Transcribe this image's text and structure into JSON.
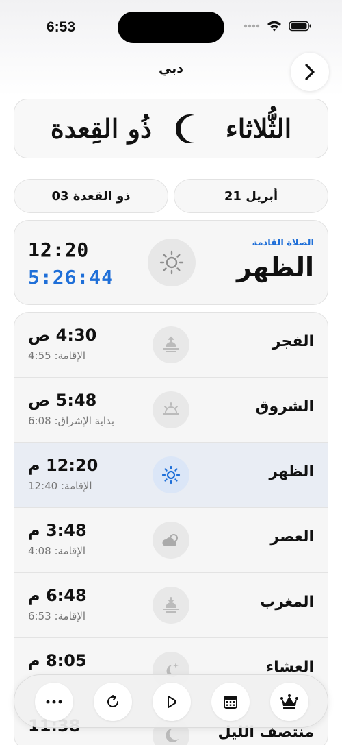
{
  "status_bar": {
    "time": "6:53"
  },
  "header": {
    "city": "دبي",
    "back_icon": "chevron-right-icon"
  },
  "calligraphy": {
    "day": "الثُّلاثاء",
    "month": "ذُو القِعدة",
    "crescent_icon": "crescent-moon-icon"
  },
  "dates": {
    "gregorian": "21 أبريل",
    "hijri": "03 ذو القعدة"
  },
  "next_prayer": {
    "label": "الصلاة القادمة",
    "name": "الظهر",
    "time": "12:20",
    "countdown": "5:26:44",
    "icon": "sun-icon"
  },
  "prayers": [
    {
      "name": "الفجر",
      "time": "4:30 ص",
      "sub": "الإقامة: 4:55",
      "icon": "sunrise-icon",
      "active": false
    },
    {
      "name": "الشروق",
      "time": "5:48 ص",
      "sub": "بداية الإشراق: 6:08",
      "icon": "sunrise-horizon-icon",
      "active": false
    },
    {
      "name": "الظهر",
      "time": "12:20 م",
      "sub": "الإقامة: 12:40",
      "icon": "sun-icon",
      "active": true
    },
    {
      "name": "العصر",
      "time": "3:48 م",
      "sub": "الإقامة: 4:08",
      "icon": "cloud-sun-icon",
      "active": false
    },
    {
      "name": "المغرب",
      "time": "6:48 م",
      "sub": "الإقامة: 6:53",
      "icon": "sunset-icon",
      "active": false
    },
    {
      "name": "العشاء",
      "time": "8:05 م",
      "sub": "",
      "icon": "moon-stars-icon",
      "active": false
    },
    {
      "name": "منتصف الليل",
      "time": "11:38",
      "sub": "",
      "icon": "moon-icon",
      "active": false
    }
  ],
  "toolbar": [
    "more-icon",
    "refresh-icon",
    "speaker-icon",
    "calendar-icon",
    "crown-icon"
  ],
  "colors": {
    "accent": "#1f6fd8",
    "active_row": "#e9edf4"
  }
}
